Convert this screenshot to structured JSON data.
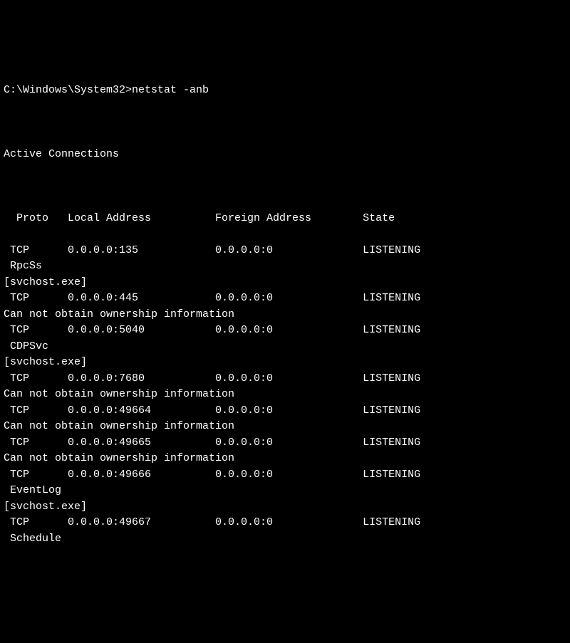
{
  "prompt": "C:\\Windows\\System32>",
  "command": "netstat -anb",
  "title": "Active Connections",
  "headers": {
    "proto": "Proto",
    "local": "Local Address",
    "foreign": "Foreign Address",
    "state": "State"
  },
  "entries": [
    {
      "proto": "TCP",
      "local": "0.0.0.0:135",
      "foreign": "0.0.0.0:0",
      "state": "LISTENING",
      "extra": [
        {
          "type": "service",
          "text": "RpcSs"
        },
        {
          "type": "owner",
          "text": "[svchost.exe]"
        }
      ]
    },
    {
      "proto": "TCP",
      "local": "0.0.0.0:445",
      "foreign": "0.0.0.0:0",
      "state": "LISTENING",
      "extra": [
        {
          "type": "owner",
          "text": "Can not obtain ownership information"
        }
      ]
    },
    {
      "proto": "TCP",
      "local": "0.0.0.0:5040",
      "foreign": "0.0.0.0:0",
      "state": "LISTENING",
      "extra": [
        {
          "type": "service",
          "text": "CDPSvc"
        },
        {
          "type": "owner",
          "text": "[svchost.exe]"
        }
      ]
    },
    {
      "proto": "TCP",
      "local": "0.0.0.0:7680",
      "foreign": "0.0.0.0:0",
      "state": "LISTENING",
      "extra": [
        {
          "type": "owner",
          "text": "Can not obtain ownership information"
        }
      ]
    },
    {
      "proto": "TCP",
      "local": "0.0.0.0:49664",
      "foreign": "0.0.0.0:0",
      "state": "LISTENING",
      "extra": [
        {
          "type": "owner",
          "text": "Can not obtain ownership information"
        }
      ]
    },
    {
      "proto": "TCP",
      "local": "0.0.0.0:49665",
      "foreign": "0.0.0.0:0",
      "state": "LISTENING",
      "extra": [
        {
          "type": "owner",
          "text": "Can not obtain ownership information"
        }
      ]
    },
    {
      "proto": "TCP",
      "local": "0.0.0.0:49666",
      "foreign": "0.0.0.0:0",
      "state": "LISTENING",
      "extra": [
        {
          "type": "service",
          "text": "EventLog"
        },
        {
          "type": "owner",
          "text": "[svchost.exe]"
        }
      ]
    },
    {
      "proto": "TCP",
      "local": "0.0.0.0:49667",
      "foreign": "0.0.0.0:0",
      "state": "LISTENING",
      "extra": [
        {
          "type": "service",
          "text": "Schedule"
        }
      ]
    }
  ]
}
